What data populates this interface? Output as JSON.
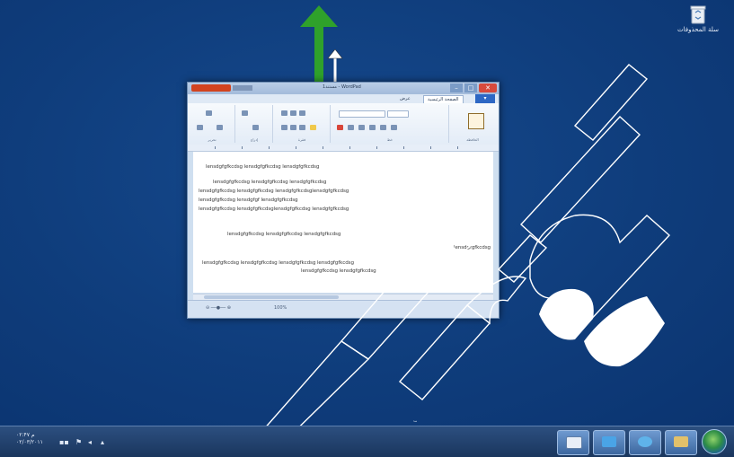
{
  "desktop": {
    "recycle_bin": {
      "label": "سلة المحذوفات",
      "icon": "recycle-bin-icon"
    }
  },
  "drag_hint": {
    "green_arrow": "arrow-up-icon",
    "white_arrow": "resize-vertical-icon"
  },
  "window": {
    "title": "مستند1 - WordPad",
    "tabs": [
      {
        "label": "عرض"
      },
      {
        "label": "الصفحة الرئيسية"
      }
    ],
    "file_tab": "▾",
    "ribbon_groups": [
      {
        "label": "الحافظة"
      },
      {
        "label": "خط"
      },
      {
        "label": "فقرة"
      },
      {
        "label": "إدراج"
      },
      {
        "label": "تحرير"
      }
    ],
    "document_lines": [
      "lensdgfgfkcdsg    lensdgfgfkcdsg    lensdgfgfkcdsg",
      "lensdgfgfkcdsg         lensdgfgfkcdsg         lensdgfgfkcdsg",
      "lensdgfgfkcdsg    lensdgfgfkcdsg  lensdgfgfkcdsglensdgfgfkcdsg",
      "lensdgfgfkcdsg    lensdgfgf        lensdgfgfkcdsg",
      "lensdgfgfkcdsg lensdgfgfkcdsglensdgfgfkcdsg lensdgfgfkcdsg",
      "lensdgfgfkcdsg    lensdgfgfkcdsg    lensdgfgfkcdsg",
      "lensdgfgfkcdsg",
      "lensdgfgfkcdsg   lensdgfgfkcdsg         lensdgfgfkcdsg   lensdgfgfkcdsg",
      "lensdgfgfkcdsg    lensdgfgfkcdsg"
    ],
    "status_zoom": "100%"
  },
  "taskbar": {
    "clock_time": "۰۲:۴۷ م",
    "clock_date": "۰۲/۰۳/۲۰۱۱",
    "buttons": [
      "explorer",
      "ie",
      "media",
      "wordpad"
    ]
  },
  "watermark": "Trial",
  "colors": {
    "desktop": "#0f3d7c",
    "taskbar": "#1f3e6a",
    "green_arrow": "#2fa12b",
    "close_button": "#d84a3c"
  }
}
